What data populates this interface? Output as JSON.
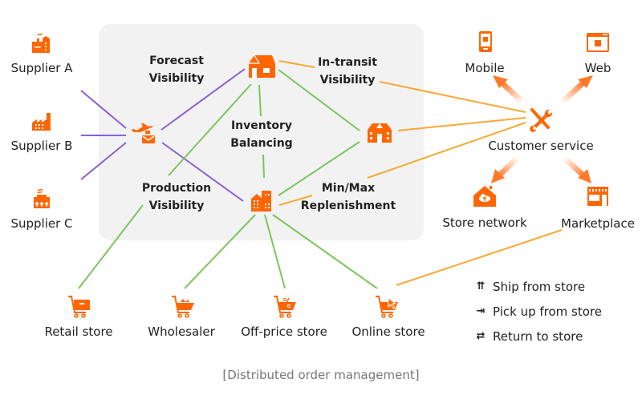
{
  "colors": {
    "accent": "#ff6600",
    "purple_link": "#8a5fd6",
    "green_link": "#7dc55e",
    "yellow_link": "#f7a934",
    "panel": "#f2f2f2",
    "caption": "#777777"
  },
  "suppliers": [
    {
      "label": "Supplier A",
      "icon": "factory-smoke-icon"
    },
    {
      "label": "Supplier B",
      "icon": "factory-chimney-icon"
    },
    {
      "label": "Supplier C",
      "icon": "factory-heat-icon"
    }
  ],
  "hub": {
    "transport_icon": "plane-ship-icon",
    "labels": {
      "forecast": [
        "Forecast",
        "Visibility"
      ],
      "in_transit": [
        "In-transit",
        "Visibility"
      ],
      "inventory": [
        "Inventory",
        "Balancing"
      ],
      "production": [
        "Production",
        "Visibility"
      ],
      "minmax": [
        "Min/Max",
        "Replenishment"
      ]
    },
    "nodes": {
      "warehouse": "warehouse-icon",
      "distribution_center": "building-icon",
      "store_cluster": "city-buildings-icon"
    }
  },
  "channels": {
    "mobile": "Mobile",
    "web": "Web",
    "customer_service": "Customer service",
    "store_network": "Store network",
    "marketplace": "Marketplace"
  },
  "stores": [
    {
      "label": "Retail store",
      "icon": "cart-box-icon"
    },
    {
      "label": "Wholesaler",
      "icon": "cart-full-icon"
    },
    {
      "label": "Off-price store",
      "icon": "cart-percent-icon"
    },
    {
      "label": "Online store",
      "icon": "cart-cursor-icon"
    }
  ],
  "legend": [
    {
      "glyph": "⇈",
      "label": "Ship from store"
    },
    {
      "glyph": "⇥",
      "label": "Pick up from store"
    },
    {
      "glyph": "⇄",
      "label": "Return to store"
    }
  ],
  "caption": "[Distributed order management]"
}
